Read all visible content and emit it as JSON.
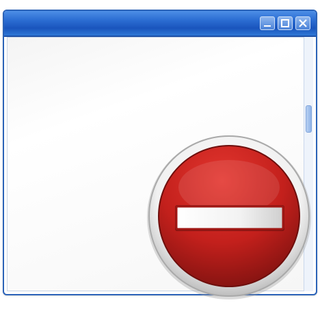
{
  "window": {
    "title": "",
    "controls": {
      "minimize_icon": "minimize-icon",
      "maximize_icon": "maximize-icon",
      "close_icon": "close-icon"
    },
    "colors": {
      "titlebar": "#2d6fd4",
      "border": "#2a62b8",
      "client": "#ffffff"
    }
  },
  "overlay": {
    "icon": "remove-icon",
    "colors": {
      "disc": "#c8221f",
      "ring": "#ffffff",
      "bar": "#ffffff"
    }
  }
}
